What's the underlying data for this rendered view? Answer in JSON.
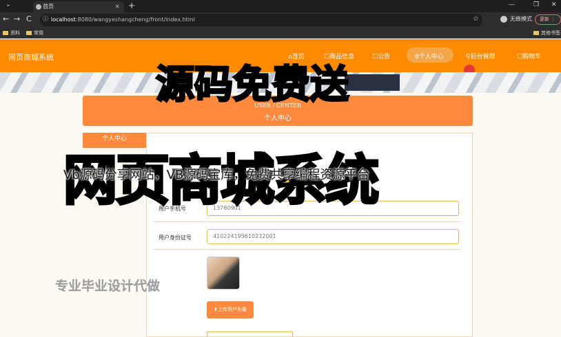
{
  "browser": {
    "tab_title": "首页",
    "tab_close": "×",
    "new_tab": "+",
    "window_controls": [
      "⌄",
      "—",
      "❐",
      "✕"
    ],
    "nav": {
      "back": "←",
      "forward": "→",
      "reload": "C",
      "info": "ⓘ"
    },
    "url_host": "localhost",
    "url_rest": ":8080/wangyeshangcheng/front/index.html",
    "star": "☆",
    "profile_label": "无痕模式",
    "relaunch_label": "更新 ⋮",
    "bookmarks": [
      "资料",
      "常用"
    ],
    "other_bookmarks": "其他书签"
  },
  "site": {
    "logo": "网页商城系统",
    "nav_items": [
      "⌂首页",
      "☐商品信息",
      "☐公告",
      "8个人中心",
      "⚲后台管理",
      "☐购物车"
    ],
    "title_en": "USER / CENTER",
    "title_cn": "个人中心",
    "sidebar_active": "个人中心",
    "form": {
      "phone_label": "用户手机号",
      "phone_value": "13780901",
      "id_label": "用户身份证号",
      "id_value": "410224199610232001",
      "upload_label": "⬆上传用户头像"
    }
  },
  "overlay": {
    "top_text": "源码免费送",
    "big_text": "网页商城系统",
    "watermark": "Vb源码分享网站，VB源码宝库，免费共享编程资源平台",
    "left_text": "专业毕业设计代做"
  },
  "colors": {
    "accent": "#ff8a00",
    "panel_orange": "#ff8a3d",
    "overlay_yellow": "#fde04a"
  }
}
